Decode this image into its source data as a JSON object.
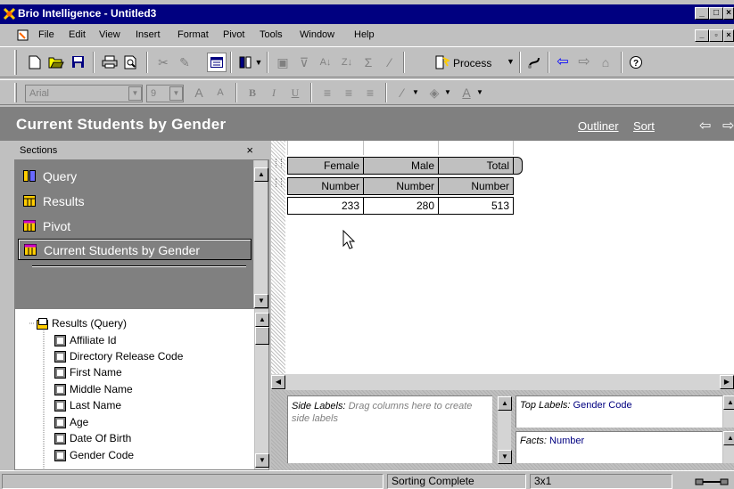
{
  "window": {
    "title": "Brio Intelligence - Untitled3",
    "controls": [
      "minimize",
      "maximize",
      "close"
    ]
  },
  "menu": {
    "items": [
      {
        "label": "File"
      },
      {
        "label": "Edit"
      },
      {
        "label": "View"
      },
      {
        "label": "Insert"
      },
      {
        "label": "Format"
      },
      {
        "label": "Pivot"
      },
      {
        "label": "Tools"
      },
      {
        "label": "Window"
      },
      {
        "label": "Help"
      }
    ]
  },
  "toolbar": {
    "process_label": "Process",
    "font_name": "Arial",
    "font_size": "9",
    "buttons": [
      "new-icon",
      "open-icon",
      "save-icon",
      "print-icon",
      "print-preview-icon",
      "cut-icon",
      "copy-icon",
      "paste-icon",
      "view-icon",
      "insert-icon",
      "add-computed-icon",
      "filter-icon",
      "sort-ascending-icon",
      "sort-descending-icon",
      "sum-icon",
      "pen-icon",
      "process-icon",
      "connect-icon",
      "back-icon",
      "forward-icon",
      "home-icon",
      "help-icon"
    ]
  },
  "banner": {
    "title": "Current Students by Gender",
    "outliner_label": "Outliner",
    "sort_label": "Sort"
  },
  "sections": {
    "header": "Sections",
    "close_label": "×",
    "items": [
      {
        "label": "Query",
        "icon": "query-icon"
      },
      {
        "label": "Results",
        "icon": "results-icon"
      },
      {
        "label": "Pivot",
        "icon": "pivot-icon"
      },
      {
        "label": "Current Students by Gender",
        "icon": "pivot-icon",
        "selected": true
      }
    ]
  },
  "tree": {
    "root": "Results (Query)",
    "items": [
      {
        "label": "Affiliate Id"
      },
      {
        "label": "Directory Release Code"
      },
      {
        "label": "First Name"
      },
      {
        "label": "Middle Name"
      },
      {
        "label": "Last Name"
      },
      {
        "label": "Age"
      },
      {
        "label": "Date Of Birth"
      },
      {
        "label": "Gender Code"
      }
    ]
  },
  "pivot": {
    "top_headers": [
      "Female",
      "Male",
      "Total"
    ],
    "fact_headers": [
      "Number",
      "Number",
      "Number"
    ],
    "values": [
      "233",
      "280",
      "513"
    ]
  },
  "dropzones": {
    "side_label": "Side Labels:",
    "side_hint": "Drag columns here to create side labels",
    "top_label": "Top Labels:",
    "top_value": "Gender Code",
    "facts_label": "Facts:",
    "facts_value": "Number"
  },
  "status": {
    "message": "Sorting Complete",
    "dimensions": "3x1"
  },
  "colors": {
    "titlebar": "#000080",
    "banner": "#808080",
    "face": "#c0c0c0",
    "link": "#000080"
  }
}
